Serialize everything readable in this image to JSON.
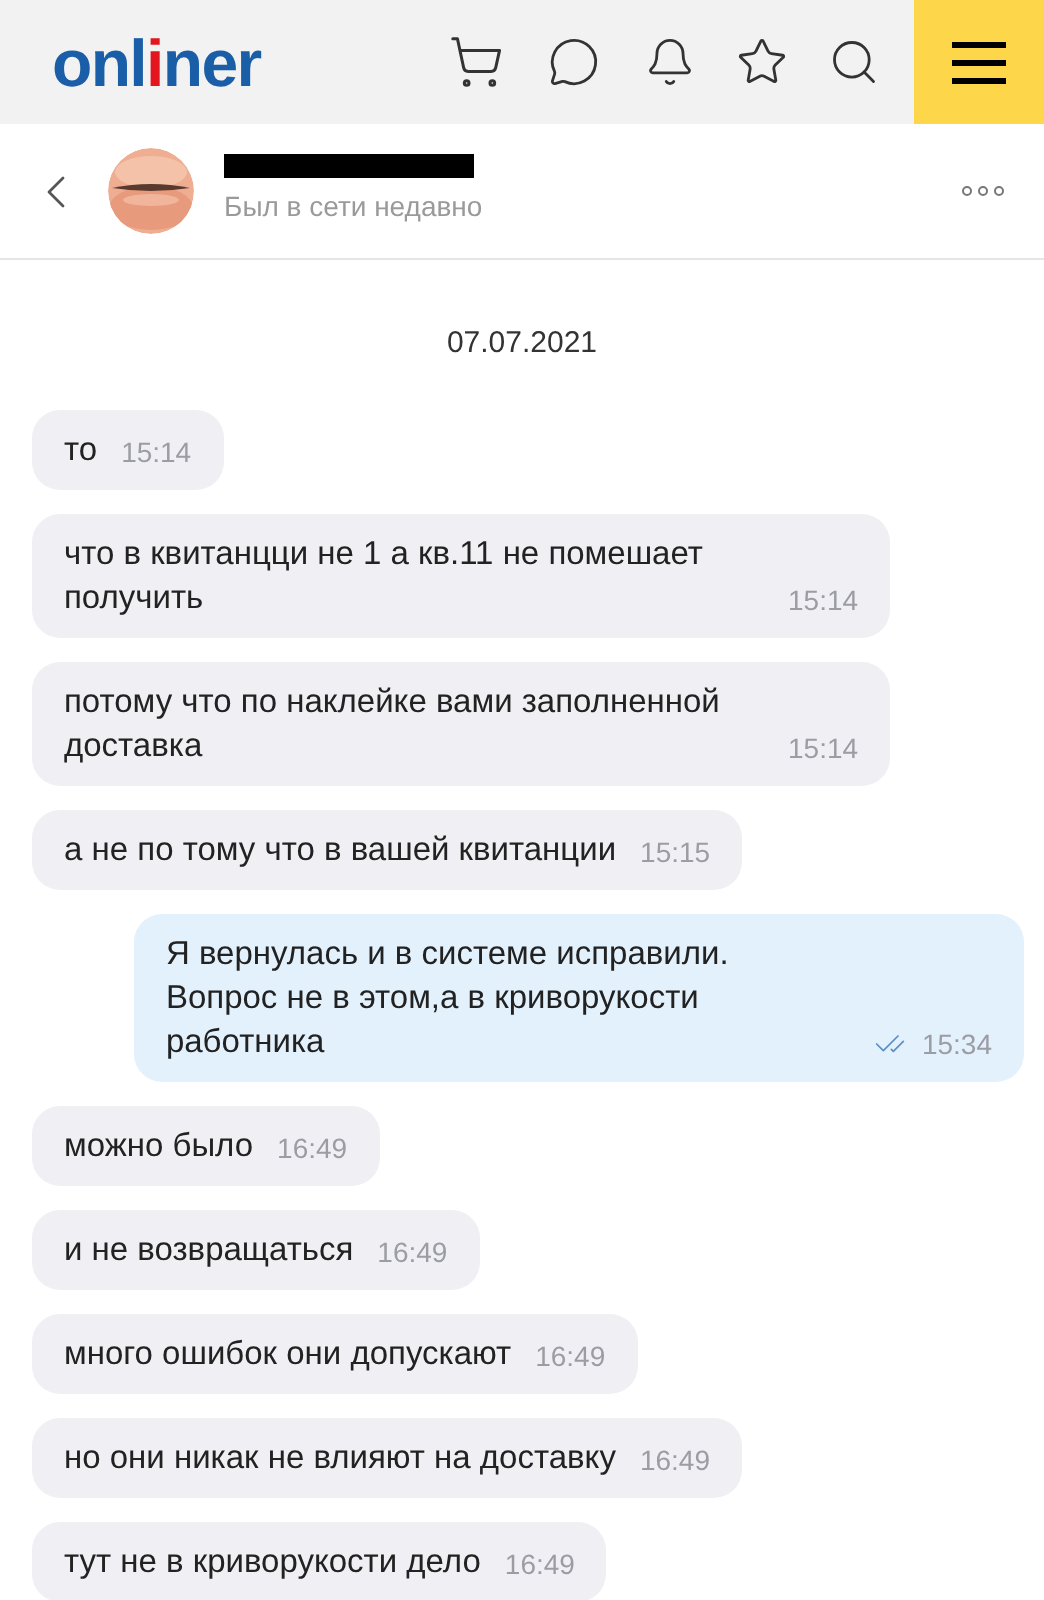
{
  "logo": {
    "start": "onl",
    "accent": "i",
    "end": "ner"
  },
  "contact": {
    "status": "Был в сети недавно",
    "name_redacted": true
  },
  "date": "07.07.2021",
  "messages": [
    {
      "kind": "in",
      "text": "то",
      "time": "15:14"
    },
    {
      "kind": "in",
      "text": "что в квитанцци не 1 а кв.11 не помешает получить",
      "time": "15:14"
    },
    {
      "kind": "in",
      "text": "потому что по наклейке вами заполненной доставка",
      "time": "15:14"
    },
    {
      "kind": "in",
      "text": "а не по тому что в вашей квитанции",
      "time": "15:15"
    },
    {
      "kind": "out",
      "text": "Я вернулась и в системе исправили. Вопрос не в этом,а в криворукости работника",
      "time": "15:34",
      "read": true
    },
    {
      "kind": "in",
      "text": "можно было",
      "time": "16:49"
    },
    {
      "kind": "in",
      "text": "и не возвращаться",
      "time": "16:49"
    },
    {
      "kind": "in",
      "text": "много ошибок они допускают",
      "time": "16:49"
    },
    {
      "kind": "in",
      "text": "но они никак не влияют на доставку",
      "time": "16:49"
    },
    {
      "kind": "in",
      "text": "тут не в криворукости дело",
      "time": "16:49"
    }
  ]
}
